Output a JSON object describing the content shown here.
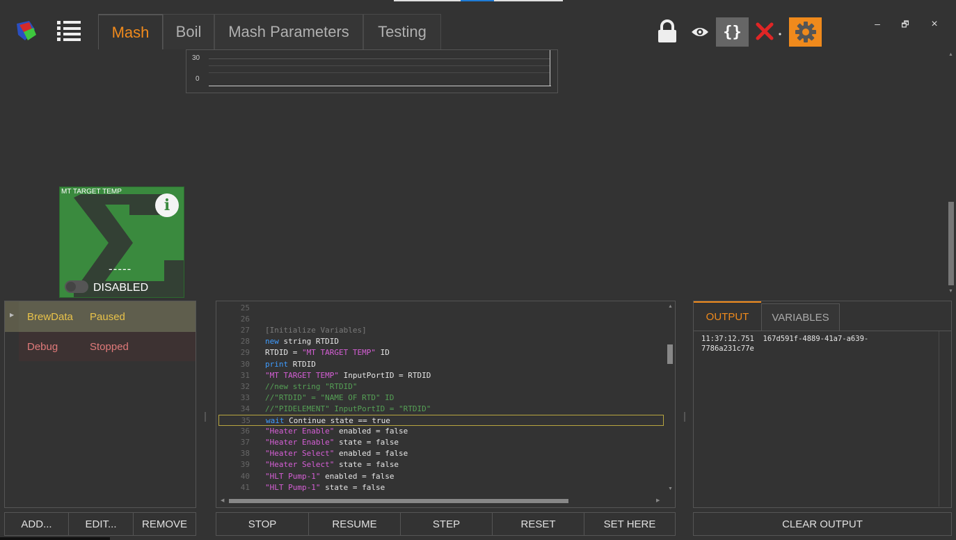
{
  "tabs": [
    {
      "label": "Mash",
      "active": true
    },
    {
      "label": "Boil",
      "active": false
    },
    {
      "label": "Mash Parameters",
      "active": false
    },
    {
      "label": "Testing",
      "active": false
    }
  ],
  "toolbar": {
    "braces_label": "{}",
    "minimize": "–",
    "restore": "🗗",
    "close": "×"
  },
  "graph": {
    "y_ticks": [
      "30",
      "0"
    ]
  },
  "block": {
    "title": "MT TARGET TEMP",
    "value": "-----",
    "status": "DISABLED",
    "info_glyph": "i"
  },
  "sessions": [
    {
      "name": "BrewData",
      "state": "Paused",
      "color": "#e8c24a"
    },
    {
      "name": "Debug",
      "state": "Stopped",
      "color": "#e07a7a"
    }
  ],
  "left_buttons": {
    "add": "ADD...",
    "edit": "EDIT...",
    "remove": "REMOVE"
  },
  "script_lines": [
    {
      "n": "25",
      "text": ""
    },
    {
      "n": "26",
      "text": ""
    },
    {
      "n": "27",
      "parts": [
        {
          "c": "gray",
          "t": "[Initialize Variables]"
        }
      ]
    },
    {
      "n": "28",
      "parts": [
        {
          "c": "kw",
          "t": "new"
        },
        {
          "c": "plain",
          "t": " string RTDID"
        }
      ]
    },
    {
      "n": "29",
      "parts": [
        {
          "c": "plain",
          "t": "RTDID = "
        },
        {
          "c": "str",
          "t": "\"MT TARGET TEMP\""
        },
        {
          "c": "plain",
          "t": " ID"
        }
      ]
    },
    {
      "n": "30",
      "parts": [
        {
          "c": "kw",
          "t": "print"
        },
        {
          "c": "plain",
          "t": " RTDID"
        }
      ]
    },
    {
      "n": "31",
      "parts": [
        {
          "c": "str",
          "t": "\"MT TARGET TEMP\""
        },
        {
          "c": "plain",
          "t": " InputPortID = RTDID"
        }
      ]
    },
    {
      "n": "32",
      "parts": [
        {
          "c": "cmt",
          "t": "//new string \"RTDID\""
        }
      ]
    },
    {
      "n": "33",
      "parts": [
        {
          "c": "cmt",
          "t": "//\"RTDID\" = \"NAME OF RTD\" ID"
        }
      ]
    },
    {
      "n": "34",
      "parts": [
        {
          "c": "cmt",
          "t": "//\"PIDELEMENT\" InputPortID = \"RTDID\""
        }
      ]
    },
    {
      "n": "35",
      "parts": [
        {
          "c": "kw",
          "t": "wait"
        },
        {
          "c": "plain",
          "t": " Continue state == true"
        }
      ],
      "highlight": true
    },
    {
      "n": "36",
      "parts": [
        {
          "c": "str",
          "t": "\"Heater Enable\""
        },
        {
          "c": "plain",
          "t": " enabled = false"
        }
      ]
    },
    {
      "n": "37",
      "parts": [
        {
          "c": "str",
          "t": "\"Heater Enable\""
        },
        {
          "c": "plain",
          "t": " state = false"
        }
      ]
    },
    {
      "n": "38",
      "parts": [
        {
          "c": "str",
          "t": "\"Heater Select\""
        },
        {
          "c": "plain",
          "t": " enabled = false"
        }
      ]
    },
    {
      "n": "39",
      "parts": [
        {
          "c": "str",
          "t": "\"Heater Select\""
        },
        {
          "c": "plain",
          "t": " state = false"
        }
      ]
    },
    {
      "n": "40",
      "parts": [
        {
          "c": "str",
          "t": "\"HLT Pump-1\""
        },
        {
          "c": "plain",
          "t": " enabled = false"
        }
      ]
    },
    {
      "n": "41",
      "parts": [
        {
          "c": "str",
          "t": "\"HLT Pump-1\""
        },
        {
          "c": "plain",
          "t": " state = false"
        }
      ]
    }
  ],
  "script_buttons": {
    "stop": "STOP",
    "resume": "RESUME",
    "step": "STEP",
    "reset": "RESET",
    "set_here": "SET HERE"
  },
  "output_tabs": [
    {
      "label": "OUTPUT",
      "active": true
    },
    {
      "label": "VARIABLES",
      "active": false
    }
  ],
  "output_text_line1": "11:37:12.751  167d591f-4889-41a7-a639-",
  "output_text_line2": "7786a231c77e",
  "clear_output": "CLEAR OUTPUT",
  "colors": {
    "accent": "#f08a1c",
    "block_green": "#3a8a3e",
    "keyword": "#3f9cff",
    "string": "#d65fd6",
    "comment": "#55a055"
  }
}
